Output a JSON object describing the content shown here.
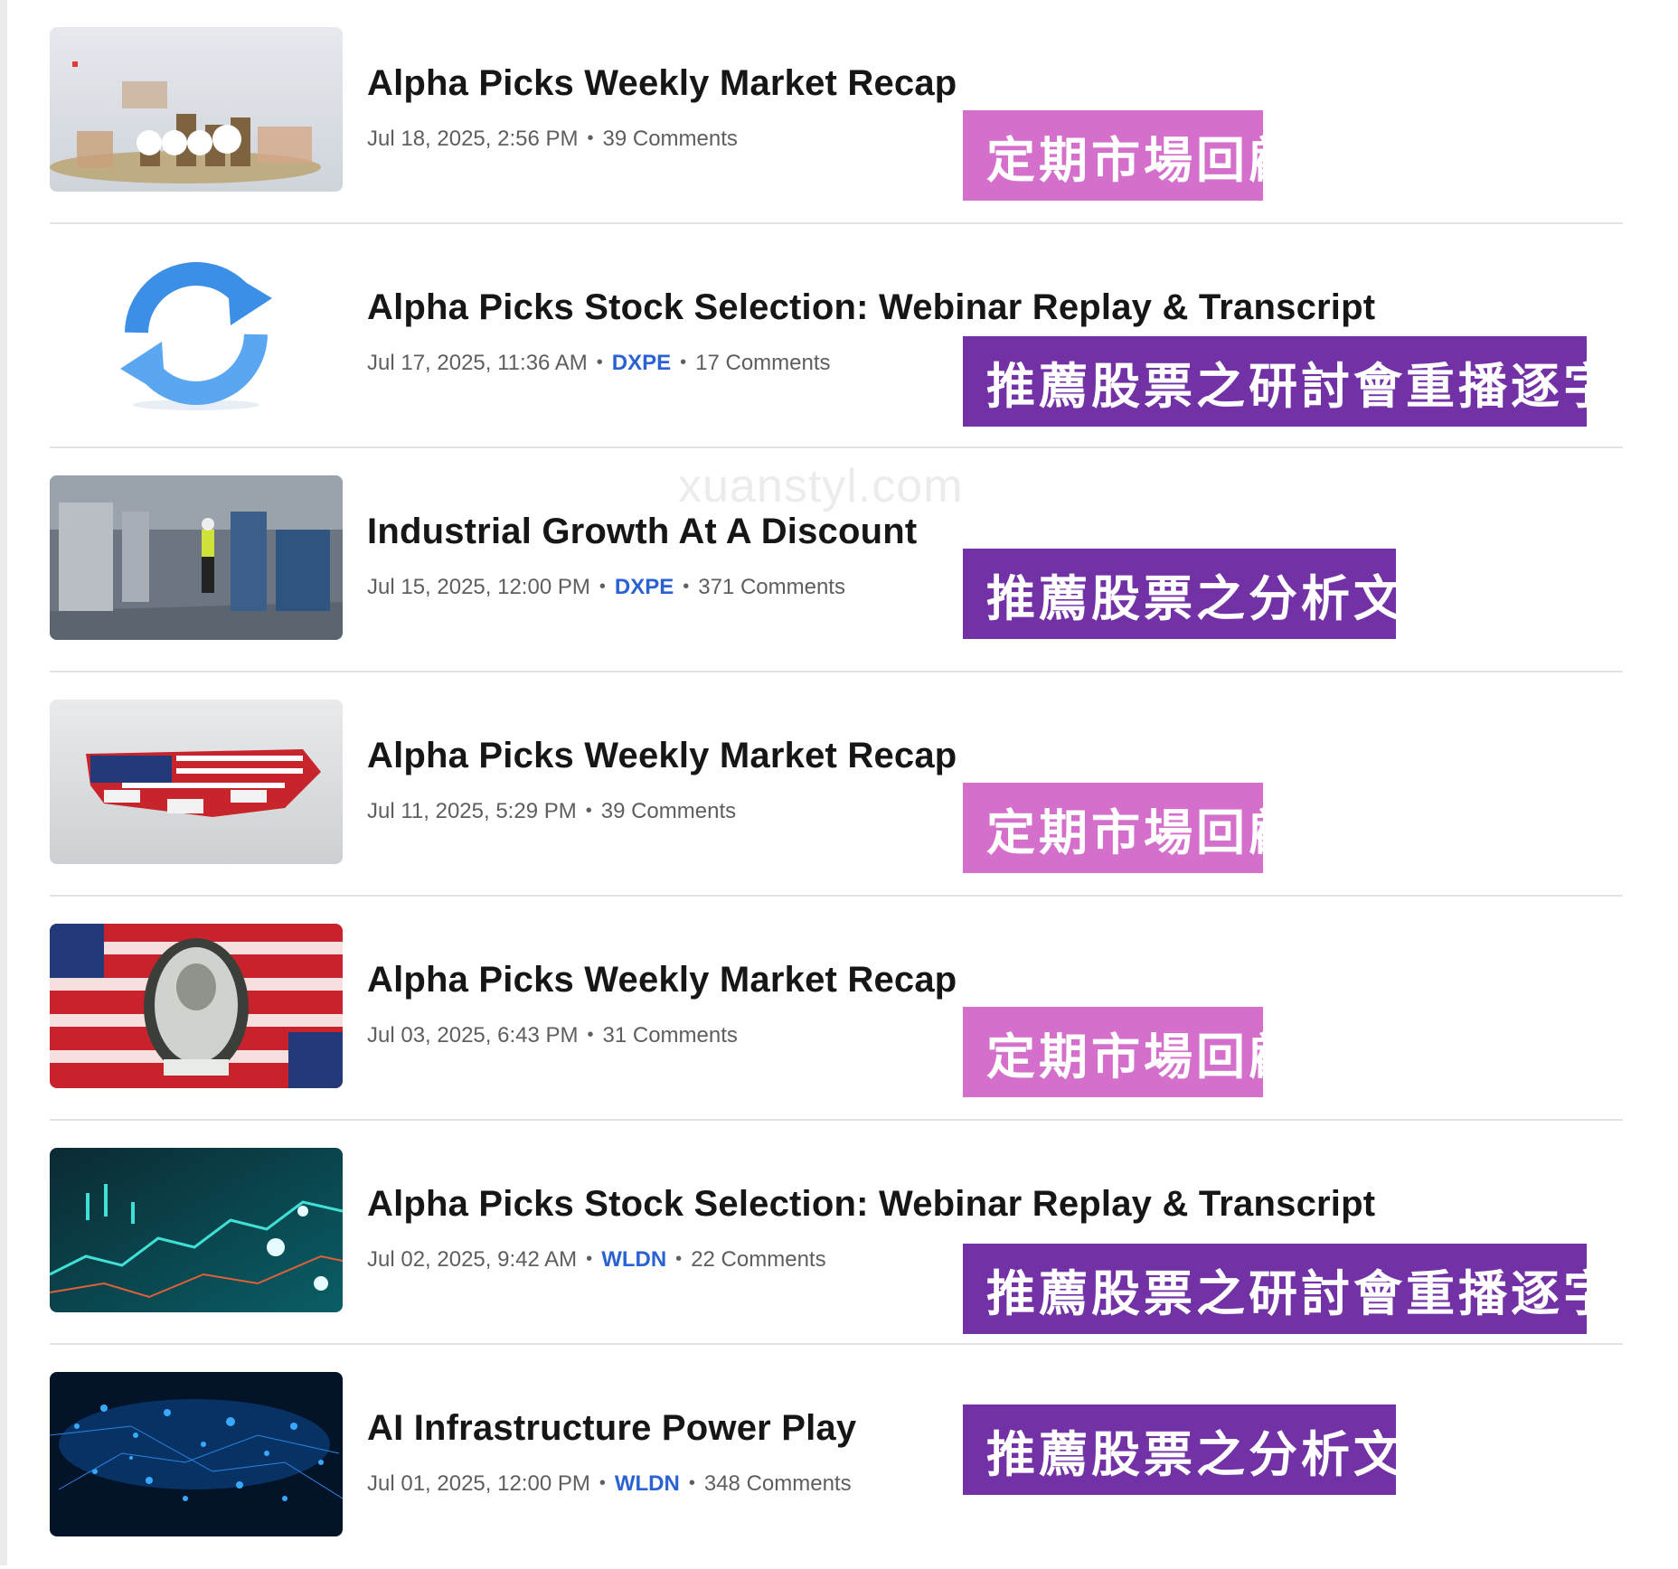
{
  "watermark": "xuanstyl.com",
  "colors": {
    "tag_pink": "#d56fcc",
    "tag_purple": "#7232a6",
    "ticker": "#2a62d3"
  },
  "articles": [
    {
      "title": "Alpha Picks Weekly Market Recap",
      "date": "Jul 18, 2025, 2:56 PM",
      "ticker": "",
      "comments": "39 Comments",
      "tag": "定期市場回顧",
      "tag_color": "#d56fcc",
      "thumbnail_icon": "cpi-coins-image"
    },
    {
      "title": "Alpha Picks Stock Selection: Webinar Replay & Transcript",
      "date": "Jul 17, 2025, 11:36 AM",
      "ticker": "DXPE",
      "comments": "17 Comments",
      "tag": "推薦股票之研討會重播逐字稿",
      "tag_color": "#7232a6",
      "thumbnail_icon": "refresh-arrows-icon"
    },
    {
      "title": "Industrial Growth At A Discount",
      "date": "Jul 15, 2025, 12:00 PM",
      "ticker": "DXPE",
      "comments": "371 Comments",
      "tag": "推薦股票之分析文章",
      "tag_color": "#7232a6",
      "thumbnail_icon": "industrial-plant-image"
    },
    {
      "title": "Alpha Picks Weekly Market Recap",
      "date": "Jul 11, 2025, 5:29 PM",
      "ticker": "",
      "comments": "39 Comments",
      "tag": "定期市場回顧",
      "tag_color": "#d56fcc",
      "thumbnail_icon": "us-flag-map-tariffs-image"
    },
    {
      "title": "Alpha Picks Weekly Market Recap",
      "date": "Jul 03, 2025, 6:43 PM",
      "ticker": "",
      "comments": "31 Comments",
      "tag": "定期市場回顧",
      "tag_color": "#d56fcc",
      "thumbnail_icon": "dollar-washington-flags-image"
    },
    {
      "title": "Alpha Picks Stock Selection: Webinar Replay & Transcript",
      "date": "Jul 02, 2025, 9:42 AM",
      "ticker": "WLDN",
      "comments": "22 Comments",
      "tag": "推薦股票之研討會重播逐字稿",
      "tag_color": "#7232a6",
      "thumbnail_icon": "stock-chart-teal-image"
    },
    {
      "title": "AI Infrastructure Power Play",
      "date": "Jul 01, 2025, 12:00 PM",
      "ticker": "WLDN",
      "comments": "348 Comments",
      "tag": "推薦股票之分析文章",
      "tag_color": "#7232a6",
      "thumbnail_icon": "blue-network-lights-image"
    }
  ]
}
